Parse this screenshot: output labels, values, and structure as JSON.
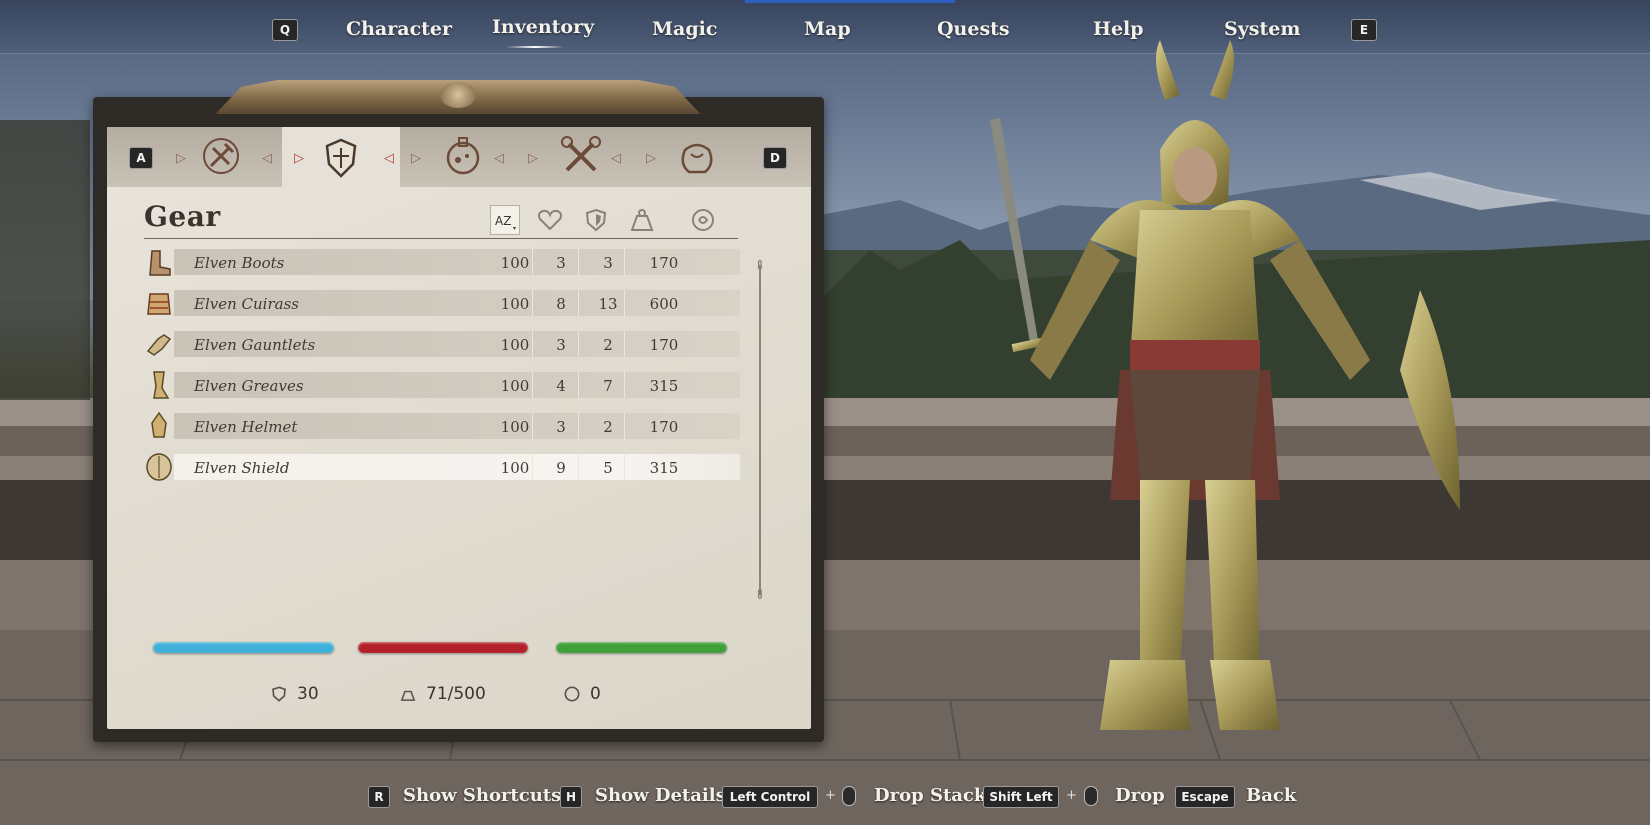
{
  "nav": {
    "left_key": "Q",
    "right_key": "E",
    "items": [
      "Character",
      "Inventory",
      "Magic",
      "Map",
      "Quests",
      "Help",
      "System"
    ],
    "active": "Inventory"
  },
  "category_tabs": {
    "left_key": "A",
    "right_key": "D",
    "tabs": [
      {
        "icon": "weapons-icon"
      },
      {
        "icon": "armor-icon",
        "active": true
      },
      {
        "icon": "potions-icon"
      },
      {
        "icon": "tools-icon"
      },
      {
        "icon": "misc-bag-icon"
      }
    ]
  },
  "panel": {
    "title": "Gear",
    "sort_columns": [
      {
        "icon": "sort-az-icon",
        "active": true
      },
      {
        "icon": "health-heart-icon"
      },
      {
        "icon": "armor-rating-icon"
      },
      {
        "icon": "weight-icon"
      },
      {
        "icon": "value-coin-icon"
      }
    ],
    "items": [
      {
        "name": "Elven Boots",
        "icon": "boots-icon",
        "condition": "100",
        "armor": "3",
        "weight": "3",
        "value": "170"
      },
      {
        "name": "Elven Cuirass",
        "icon": "cuirass-icon",
        "condition": "100",
        "armor": "8",
        "weight": "13",
        "value": "600"
      },
      {
        "name": "Elven Gauntlets",
        "icon": "gauntlets-icon",
        "condition": "100",
        "armor": "3",
        "weight": "2",
        "value": "170"
      },
      {
        "name": "Elven Greaves",
        "icon": "greaves-icon",
        "condition": "100",
        "armor": "4",
        "weight": "7",
        "value": "315"
      },
      {
        "name": "Elven Helmet",
        "icon": "helmet-icon",
        "condition": "100",
        "armor": "3",
        "weight": "2",
        "value": "170"
      },
      {
        "name": "Elven Shield",
        "icon": "shield-icon",
        "condition": "100",
        "armor": "9",
        "weight": "5",
        "value": "315",
        "selected": true
      }
    ],
    "bars": {
      "magicka": 1.0,
      "health": 1.0,
      "fatigue": 1.0
    },
    "colors": {
      "magicka": "#3fb0d8",
      "health": "#b3202a",
      "fatigue": "#3f9f3a"
    },
    "stats": {
      "armor_rating": "30",
      "encumbrance": "71/500",
      "gold": "0"
    }
  },
  "hints": [
    {
      "key": "R",
      "label": "Show Shortcuts"
    },
    {
      "key": "H",
      "label": "Show Details"
    },
    {
      "key": "Left Control",
      "label": "Drop Stack"
    },
    {
      "key": "Shift Left",
      "label": "Drop"
    },
    {
      "key": "Escape",
      "label": "Back"
    }
  ]
}
